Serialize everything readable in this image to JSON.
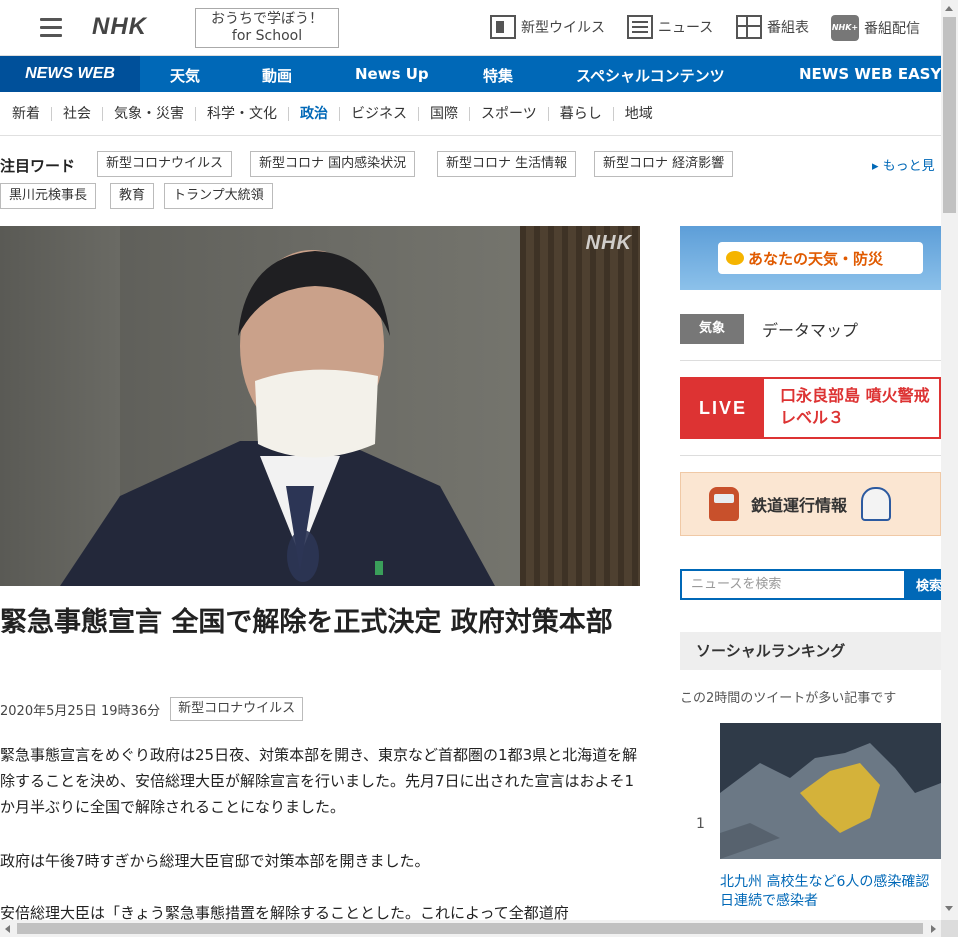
{
  "header": {
    "logo": "NHK",
    "school_line1": "おうちで学ぼう！",
    "school_line2": "for School",
    "links": [
      {
        "label": "新型ウイルス",
        "icon": "virus-news-icon"
      },
      {
        "label": "ニュース",
        "icon": "news-icon"
      },
      {
        "label": "番組表",
        "icon": "program-guide-icon"
      },
      {
        "label": "番組配信",
        "icon": "nhk-plus-icon"
      }
    ],
    "nhk_plus_badge": "NHK+"
  },
  "bluenav": {
    "brand": "NEWS WEB",
    "items": [
      "天気",
      "動画",
      "News Up",
      "特集",
      "スペシャルコンテンツ",
      "NEWS WEB EASY"
    ]
  },
  "categories": [
    "新着",
    "社会",
    "気象・災害",
    "科学・文化",
    "政治",
    "ビジネス",
    "国際",
    "スポーツ",
    "暮らし",
    "地域"
  ],
  "active_category": "政治",
  "attention": {
    "title": "注目ワード",
    "tags": [
      "新型コロナウイルス",
      "新型コロナ 国内感染状況",
      "新型コロナ 生活情報",
      "新型コロナ 経済影響",
      "黒川元検事長",
      "教育",
      "トランプ大統領"
    ],
    "more": "▸ もっと見"
  },
  "article": {
    "image_watermark": "NHK",
    "title": "緊急事態宣言 全国で解除を正式決定 政府対策本部",
    "date": "2020年5月25日 19時36分",
    "tag": "新型コロナウイルス",
    "paragraphs": [
      "緊急事態宣言をめぐり政府は25日夜、対策本部を開き、東京など首都圏の1都3県と北海道を解除することを決め、安倍総理大臣が解除宣言を行いました。先月7日に出された宣言はおよそ1か月半ぶりに全国で解除されることになりました。",
      "政府は午後7時すぎから総理大臣官邸で対策本部を開きました。",
      "安倍総理大臣は「きょう緊急事態措置を解除することとした。これによって全都道府"
    ]
  },
  "sidebar": {
    "weather_banner": "あなたの天気・防災",
    "datamap_label": "気象",
    "datamap_text": "データマップ",
    "live_label": "LIVE",
    "live_text": "口永良部島 噴火警戒レベル３",
    "rail_text": "鉄道運行情報",
    "search_placeholder": "ニュースを検索",
    "search_button": "検索",
    "ranking_title": "ソーシャルランキング",
    "ranking_sub": "この2時間のツイートが多い記事です",
    "ranking_items": [
      {
        "rank": "1",
        "text": "北九州 高校生など6人の感染確認 日連続で感染者"
      }
    ]
  },
  "colors": {
    "nhk_blue": "#0068b7",
    "live_red": "#dd3333"
  }
}
